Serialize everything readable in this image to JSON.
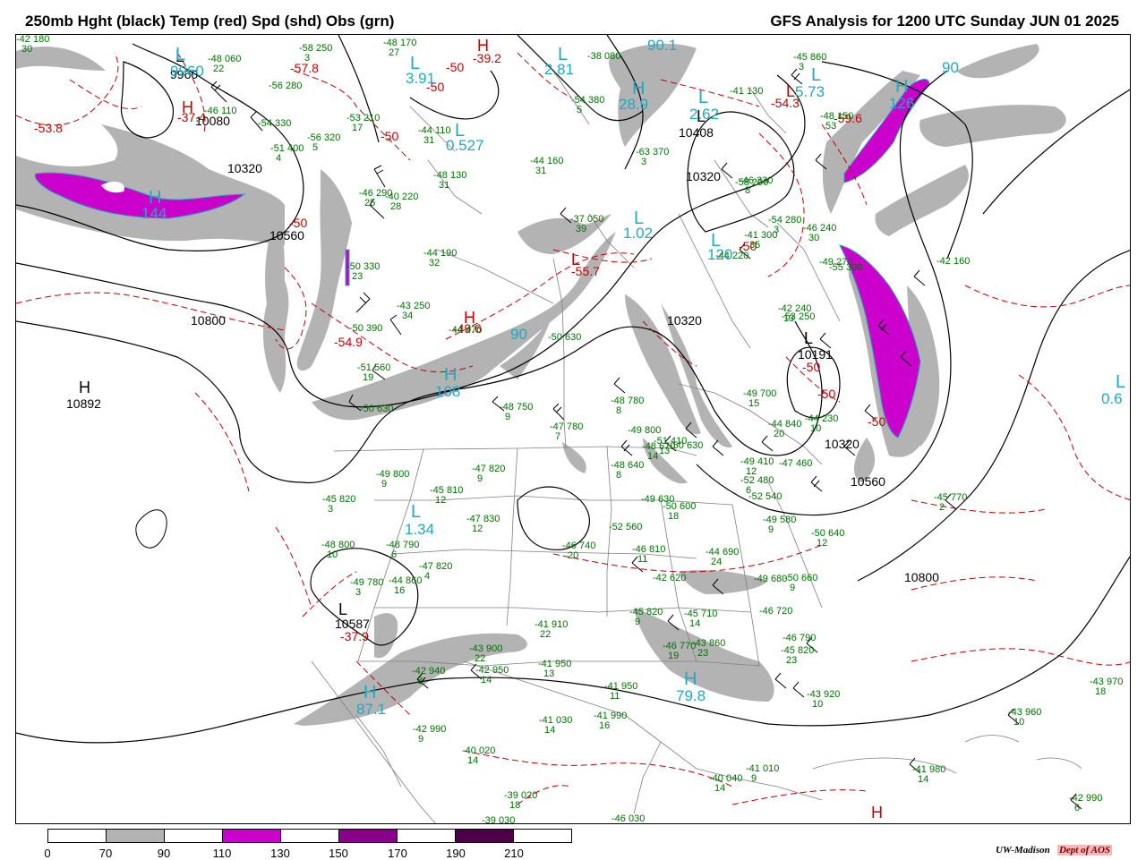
{
  "header": {
    "left_title": "250mb Hght (black) Temp (red) Spd (shd) Obs (grn)",
    "right_title": "GFS Analysis for 1200 UTC Sunday  JUN 01 2025"
  },
  "colors": {
    "height": "#000000",
    "temperature": "#c00000",
    "speed_label": "#21a9c0",
    "obs": "#007000",
    "borders": "#808080"
  },
  "heights": [
    {
      "id": "h1",
      "text": "9960"
    },
    {
      "id": "h2",
      "text": "10080"
    },
    {
      "id": "h3",
      "text": "10320"
    },
    {
      "id": "h4",
      "text": "10560"
    },
    {
      "id": "h5",
      "text": "10800"
    },
    {
      "id": "h6",
      "text": "10892"
    },
    {
      "id": "h7",
      "text": "10408"
    },
    {
      "id": "h8",
      "text": "10320"
    },
    {
      "id": "h9",
      "text": "10320"
    },
    {
      "id": "h10",
      "text": "10320"
    },
    {
      "id": "h11",
      "text": "10560"
    },
    {
      "id": "h12",
      "text": "10800"
    },
    {
      "id": "h13",
      "text": "10587"
    },
    {
      "id": "h14",
      "text": "10191"
    }
  ],
  "centers": [
    {
      "id": "c1",
      "text": "L"
    },
    {
      "id": "c2",
      "text": "H"
    },
    {
      "id": "c3",
      "text": "L"
    },
    {
      "id": "c4",
      "text": "L"
    },
    {
      "id": "c5",
      "text": "H"
    },
    {
      "id": "c6",
      "text": "L"
    },
    {
      "id": "c7",
      "text": "L"
    },
    {
      "id": "c8",
      "text": "L"
    },
    {
      "id": "c9",
      "text": "H"
    },
    {
      "id": "c10",
      "text": "L"
    },
    {
      "id": "c11",
      "text": "H"
    }
  ],
  "temps": [
    {
      "id": "t1",
      "text": "-53.8"
    },
    {
      "id": "t2",
      "text": "-57.8"
    },
    {
      "id": "t3",
      "text": "-37.4"
    },
    {
      "id": "t4",
      "text": "-50"
    },
    {
      "id": "t5",
      "text": "-50"
    },
    {
      "id": "t6",
      "text": "-50"
    },
    {
      "id": "t7",
      "text": "-39.2"
    },
    {
      "id": "t8",
      "text": "-54.3"
    },
    {
      "id": "t9",
      "text": "-59.6"
    },
    {
      "id": "t10",
      "text": "-50"
    },
    {
      "id": "t11",
      "text": "-55.7"
    },
    {
      "id": "t12",
      "text": "-54.9"
    },
    {
      "id": "t13",
      "text": "-49.6"
    },
    {
      "id": "t14",
      "text": "-50"
    },
    {
      "id": "t15",
      "text": "-50"
    },
    {
      "id": "t16",
      "text": "-50"
    },
    {
      "id": "t17",
      "text": "-37.9"
    },
    {
      "id": "t18",
      "text": "-50"
    }
  ],
  "temp_centers": [
    {
      "id": "tc1",
      "text": "H"
    },
    {
      "id": "tc2",
      "text": "H"
    },
    {
      "id": "tc3",
      "text": "L"
    },
    {
      "id": "tc4",
      "text": "H"
    },
    {
      "id": "tc5",
      "text": "L"
    },
    {
      "id": "tc6",
      "text": "H"
    }
  ],
  "speeds": [
    {
      "id": "s1",
      "text": "3.91"
    },
    {
      "id": "s2",
      "text": "0.527"
    },
    {
      "id": "s3",
      "text": "2.81"
    },
    {
      "id": "s4",
      "text": "28.9"
    },
    {
      "id": "s5",
      "text": "2.62"
    },
    {
      "id": "s6",
      "text": "90.1"
    },
    {
      "id": "s7",
      "text": "5.73"
    },
    {
      "id": "s8",
      "text": "126"
    },
    {
      "id": "s9",
      "text": "90"
    },
    {
      "id": "s10",
      "text": "144"
    },
    {
      "id": "s11",
      "text": "1.02"
    },
    {
      "id": "s12",
      "text": "120"
    },
    {
      "id": "s13",
      "text": "108"
    },
    {
      "id": "s14",
      "text": "90"
    },
    {
      "id": "s15",
      "text": "1.34"
    },
    {
      "id": "s16",
      "text": "87.1"
    },
    {
      "id": "s17",
      "text": "79.8"
    },
    {
      "id": "s18",
      "text": "0.6"
    },
    {
      "id": "s19",
      "text": "9960"
    }
  ],
  "speed_centers": [
    {
      "id": "sc1",
      "text": "L"
    },
    {
      "id": "sc2",
      "text": "L"
    },
    {
      "id": "sc3",
      "text": "L"
    },
    {
      "id": "sc4",
      "text": "H"
    },
    {
      "id": "sc5",
      "text": "L"
    },
    {
      "id": "sc6",
      "text": "L"
    },
    {
      "id": "sc7",
      "text": "L"
    },
    {
      "id": "sc8",
      "text": "H"
    },
    {
      "id": "sc9",
      "text": "L"
    },
    {
      "id": "sc10",
      "text": "H"
    },
    {
      "id": "sc11",
      "text": "L"
    },
    {
      "id": "sc12",
      "text": "H"
    },
    {
      "id": "sc13",
      "text": "H"
    },
    {
      "id": "sc14",
      "text": "H"
    },
    {
      "id": "sc15",
      "text": "L"
    },
    {
      "id": "sc16",
      "text": "L"
    }
  ],
  "obs": [
    {
      "id": "o1",
      "temp": "-48",
      "hgt": "060",
      "dew": "22"
    },
    {
      "id": "o2",
      "temp": "-58",
      "hgt": "250",
      "dew": "3"
    },
    {
      "id": "o3",
      "temp": "-56",
      "hgt": "280",
      "dew": ""
    },
    {
      "id": "o4",
      "temp": "-46",
      "hgt": "110",
      "dew": ""
    },
    {
      "id": "o5",
      "temp": "-54",
      "hgt": "330",
      "dew": ""
    },
    {
      "id": "o6",
      "temp": "-51",
      "hgt": "400",
      "dew": "4"
    },
    {
      "id": "o7",
      "temp": "-56",
      "hgt": "320",
      "dew": "5"
    },
    {
      "id": "o8",
      "temp": "-48",
      "hgt": "170",
      "dew": "27"
    },
    {
      "id": "o9",
      "temp": "-53",
      "hgt": "210",
      "dew": "17"
    },
    {
      "id": "o10",
      "temp": "-44",
      "hgt": "110",
      "dew": "31"
    },
    {
      "id": "o11",
      "temp": "-44",
      "hgt": "160",
      "dew": "31"
    },
    {
      "id": "o12",
      "temp": "-48",
      "hgt": "130",
      "dew": "31"
    },
    {
      "id": "o13",
      "temp": "-46",
      "hgt": "290",
      "dew": "25"
    },
    {
      "id": "o14",
      "temp": "-40",
      "hgt": "220",
      "dew": "28"
    },
    {
      "id": "o15",
      "temp": "-44",
      "hgt": "190",
      "dew": "32"
    },
    {
      "id": "o16",
      "temp": "-50",
      "hgt": "330",
      "dew": "23"
    },
    {
      "id": "o17",
      "temp": "-43",
      "hgt": "250",
      "dew": "34"
    },
    {
      "id": "o18",
      "temp": "-50",
      "hgt": "390",
      "dew": ""
    },
    {
      "id": "o19",
      "temp": "-44",
      "hgt": "470",
      "dew": ""
    },
    {
      "id": "o20",
      "temp": "-51",
      "hgt": "560",
      "dew": "19"
    },
    {
      "id": "o21",
      "temp": "-50",
      "hgt": "630",
      "dew": ""
    },
    {
      "id": "o22",
      "temp": "-50",
      "hgt": "630",
      "dew": ""
    },
    {
      "id": "o23",
      "temp": "-48",
      "hgt": "750",
      "dew": "9"
    },
    {
      "id": "o24",
      "temp": "-47",
      "hgt": "780",
      "dew": "7"
    },
    {
      "id": "o25",
      "temp": "-48",
      "hgt": "780",
      "dew": "8"
    },
    {
      "id": "o26",
      "temp": "-47",
      "hgt": "820",
      "dew": "9"
    },
    {
      "id": "o27",
      "temp": "-49",
      "hgt": "800",
      "dew": "9"
    },
    {
      "id": "o28",
      "temp": "-45",
      "hgt": "810",
      "dew": "12"
    },
    {
      "id": "o29",
      "temp": "-49",
      "hgt": "800",
      "dew": ""
    },
    {
      "id": "o30",
      "temp": "-45",
      "hgt": "820",
      "dew": "3"
    },
    {
      "id": "o31",
      "temp": "-47",
      "hgt": "830",
      "dew": "12"
    },
    {
      "id": "o32",
      "temp": "-48",
      "hgt": "800",
      "dew": "10"
    },
    {
      "id": "o33",
      "temp": "-48",
      "hgt": "790",
      "dew": "6"
    },
    {
      "id": "o34",
      "temp": "-47",
      "hgt": "820",
      "dew": "4"
    },
    {
      "id": "o35",
      "temp": "-49",
      "hgt": "780",
      "dew": "3"
    },
    {
      "id": "o36",
      "temp": "-44",
      "hgt": "860",
      "dew": "16"
    },
    {
      "id": "o37",
      "temp": "-43",
      "hgt": "900",
      "dew": "22"
    },
    {
      "id": "o38",
      "temp": "-41",
      "hgt": "910",
      "dew": "22"
    },
    {
      "id": "o39",
      "temp": "-42",
      "hgt": "940",
      "dew": "8"
    },
    {
      "id": "o40",
      "temp": "-42",
      "hgt": "950",
      "dew": "14"
    },
    {
      "id": "o41",
      "temp": "-41",
      "hgt": "950",
      "dew": "13"
    },
    {
      "id": "o42",
      "temp": "-42",
      "hgt": "990",
      "dew": "9"
    },
    {
      "id": "o43",
      "temp": "-40",
      "hgt": "020",
      "dew": "14"
    },
    {
      "id": "o44",
      "temp": "-41",
      "hgt": "030",
      "dew": "14"
    },
    {
      "id": "o45",
      "temp": "-41",
      "hgt": "990",
      "dew": "16"
    },
    {
      "id": "o46",
      "temp": "-41",
      "hgt": "950",
      "dew": "11"
    },
    {
      "id": "o47",
      "temp": "-39",
      "hgt": "020",
      "dew": "18"
    },
    {
      "id": "o48",
      "temp": "-39",
      "hgt": "030",
      "dew": ""
    },
    {
      "id": "o49",
      "temp": "-46",
      "hgt": "030",
      "dew": ""
    },
    {
      "id": "o50",
      "temp": "-40",
      "hgt": "040",
      "dew": "14"
    },
    {
      "id": "o51",
      "temp": "-41",
      "hgt": "010",
      "dew": "9"
    },
    {
      "id": "o52",
      "temp": "-41",
      "hgt": "980",
      "dew": "14"
    },
    {
      "id": "o53",
      "temp": "-42",
      "hgt": "990",
      "dew": "6"
    },
    {
      "id": "o54",
      "temp": "-43",
      "hgt": "960",
      "dew": "10"
    },
    {
      "id": "o55",
      "temp": "-43",
      "hgt": "970",
      "dew": "18"
    },
    {
      "id": "o56",
      "temp": "-43",
      "hgt": "920",
      "dew": "10"
    },
    {
      "id": "o57",
      "temp": "-45",
      "hgt": "820",
      "dew": "23"
    },
    {
      "id": "o58",
      "temp": "-46",
      "hgt": "790",
      "dew": ""
    },
    {
      "id": "o59",
      "temp": "-46",
      "hgt": "720",
      "dew": ""
    },
    {
      "id": "o60",
      "temp": "-49",
      "hgt": "680",
      "dew": ""
    },
    {
      "id": "o61",
      "temp": "-50",
      "hgt": "660",
      "dew": "9"
    },
    {
      "id": "o62",
      "temp": "-50",
      "hgt": "640",
      "dew": "12"
    },
    {
      "id": "o63",
      "temp": "-49",
      "hgt": "580",
      "dew": "9"
    },
    {
      "id": "o64",
      "temp": "-52",
      "hgt": "540",
      "dew": ""
    },
    {
      "id": "o65",
      "temp": "-52",
      "hgt": "480",
      "dew": "6"
    },
    {
      "id": "o66",
      "temp": "-47",
      "hgt": "460",
      "dew": ""
    },
    {
      "id": "o67",
      "temp": "-49",
      "hgt": "410",
      "dew": "12"
    },
    {
      "id": "o68",
      "temp": "-51",
      "hgt": "410",
      "dew": "13"
    },
    {
      "id": "o69",
      "temp": "-50",
      "hgt": "630",
      "dew": ""
    },
    {
      "id": "o70",
      "temp": "-49",
      "hgt": "630",
      "dew": ""
    },
    {
      "id": "o71",
      "temp": "-50",
      "hgt": "600",
      "dew": "18"
    },
    {
      "id": "o72",
      "temp": "-48",
      "hgt": "670",
      "dew": "14"
    },
    {
      "id": "o73",
      "temp": "-48",
      "hgt": "640",
      "dew": "8"
    },
    {
      "id": "o74",
      "temp": "-52",
      "hgt": "560",
      "dew": ""
    },
    {
      "id": "o75",
      "temp": "-46",
      "hgt": "740",
      "dew": "20"
    },
    {
      "id": "o76",
      "temp": "-46",
      "hgt": "810",
      "dew": "11"
    },
    {
      "id": "o77",
      "temp": "-44",
      "hgt": "690",
      "dew": "24"
    },
    {
      "id": "o78",
      "temp": "-42",
      "hgt": "620",
      "dew": ""
    },
    {
      "id": "o79",
      "temp": "-45",
      "hgt": "710",
      "dew": "14"
    },
    {
      "id": "o80",
      "temp": "-46",
      "hgt": "770",
      "dew": "19"
    },
    {
      "id": "o81",
      "temp": "-45",
      "hgt": "820",
      "dew": "9"
    },
    {
      "id": "o82",
      "temp": "-43",
      "hgt": "860",
      "dew": "23"
    },
    {
      "id": "o83",
      "temp": "-44",
      "hgt": "840",
      "dew": "20"
    },
    {
      "id": "o84",
      "temp": "-49",
      "hgt": "700",
      "dew": "15"
    },
    {
      "id": "o85",
      "temp": "-44",
      "hgt": "230",
      "dew": "10"
    },
    {
      "id": "o86",
      "temp": "-53",
      "hgt": "250",
      "dew": ""
    },
    {
      "id": "o87",
      "temp": "-42",
      "hgt": "240",
      "dew": "13"
    },
    {
      "id": "o88",
      "temp": "-44",
      "hgt": "220",
      "dew": ""
    },
    {
      "id": "o89",
      "temp": "-41",
      "hgt": "300",
      "dew": "35"
    },
    {
      "id": "o90",
      "temp": "-54",
      "hgt": "280",
      "dew": "3"
    },
    {
      "id": "o91",
      "temp": "-46",
      "hgt": "240",
      "dew": "30"
    },
    {
      "id": "o92",
      "temp": "-55",
      "hgt": "300",
      "dew": ""
    },
    {
      "id": "o93",
      "temp": "-42",
      "hgt": "160",
      "dew": ""
    },
    {
      "id": "o94",
      "temp": "-45",
      "hgt": "770",
      "dew": "2"
    },
    {
      "id": "o95",
      "temp": "-45",
      "hgt": "860",
      "dew": "3"
    },
    {
      "id": "o96",
      "temp": "-48",
      "hgt": "150",
      "dew": "53"
    },
    {
      "id": "o97",
      "temp": "-41",
      "hgt": "130",
      "dew": ""
    },
    {
      "id": "o98",
      "temp": "-63",
      "hgt": "370",
      "dew": "3"
    },
    {
      "id": "o99",
      "temp": "-54",
      "hgt": "380",
      "dew": "5"
    },
    {
      "id": "o100",
      "temp": "-38",
      "hgt": "080",
      "dew": ""
    },
    {
      "id": "o101",
      "temp": "-37",
      "hgt": "050",
      "dew": "39"
    },
    {
      "id": "o102",
      "temp": "-46",
      "hgt": "330",
      "dew": "8"
    },
    {
      "id": "o103",
      "temp": "-58",
      "hgt": "290",
      "dew": ""
    },
    {
      "id": "o104",
      "temp": "-49",
      "hgt": "270",
      "dew": ""
    },
    {
      "id": "o105",
      "temp": "-42",
      "hgt": "180",
      "dew": "30"
    }
  ],
  "legend": {
    "ticks": [
      "0",
      "70",
      "90",
      "110",
      "130",
      "150",
      "170",
      "190",
      "210"
    ],
    "colors": [
      "#ffffff",
      "#b3b3b3",
      "#ffffff",
      "#cc00cc",
      "#ffffff",
      "#8b008b",
      "#ffffff",
      "#4b0048",
      "#ffffff"
    ]
  },
  "credit": {
    "org": "UW-Madison",
    "dept": "Dept of AOS"
  }
}
